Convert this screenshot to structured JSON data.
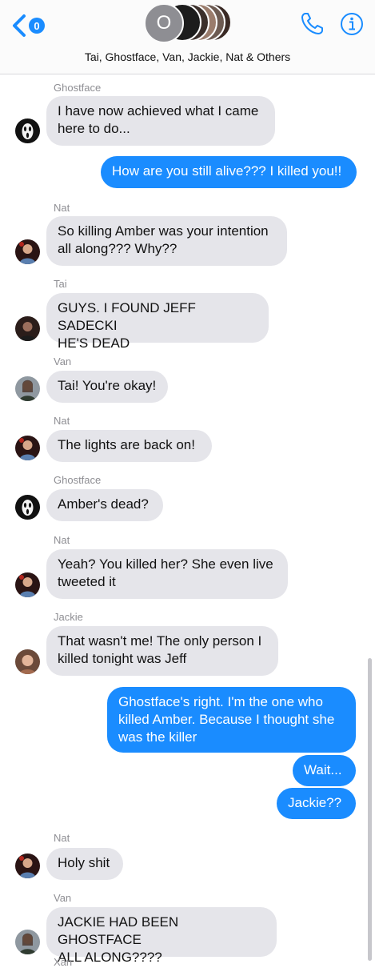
{
  "header": {
    "back_badge": "0",
    "group_initial": "O",
    "group_names": "Tai, Ghostface, Van, Jackie, Nat & Others",
    "icons": {
      "back": "chevron-left-icon",
      "phone": "phone-icon",
      "info": "info-icon"
    }
  },
  "colors": {
    "accent": "#1a8cff",
    "incoming_bubble": "#e5e5ea",
    "sender_label": "#8e8e93"
  },
  "messages": [
    {
      "sender": "Ghostface",
      "line1": "I have now achieved what I came",
      "line2": "here to do..."
    },
    {
      "sender": "",
      "line1": "How are you still alive??? I killed you!!"
    },
    {
      "sender": "Nat",
      "line1": "So killing Amber was your intention",
      "line2": "all along??? Why??"
    },
    {
      "sender": "Tai",
      "line1": "GUYS. I FOUND JEFF SADECKI",
      "line2": "HE'S DEAD"
    },
    {
      "sender": "Van",
      "line1": "Tai! You're okay!"
    },
    {
      "sender": "Nat",
      "line1": "The lights are back on!"
    },
    {
      "sender": "Ghostface",
      "line1": "Amber's dead?"
    },
    {
      "sender": "Nat",
      "line1": "Yeah? You killed her? She even live",
      "line2": "tweeted it"
    },
    {
      "sender": "Jackie",
      "line1": "That wasn't me! The only person I",
      "line2": "killed tonight was Jeff"
    },
    {
      "sender": "",
      "line1": "Ghostface's right. I'm the one who",
      "line2": "killed Amber. Because I thought she",
      "line3": "was the killer"
    },
    {
      "sender": "",
      "line1": "Wait..."
    },
    {
      "sender": "",
      "line1": "Jackie??"
    },
    {
      "sender": "Nat",
      "line1": "Holy shit"
    },
    {
      "sender": "Van",
      "line1": "JACKIE HAD BEEN GHOSTFACE",
      "line2": "ALL ALONG????"
    },
    {
      "sender": "Xan"
    }
  ]
}
